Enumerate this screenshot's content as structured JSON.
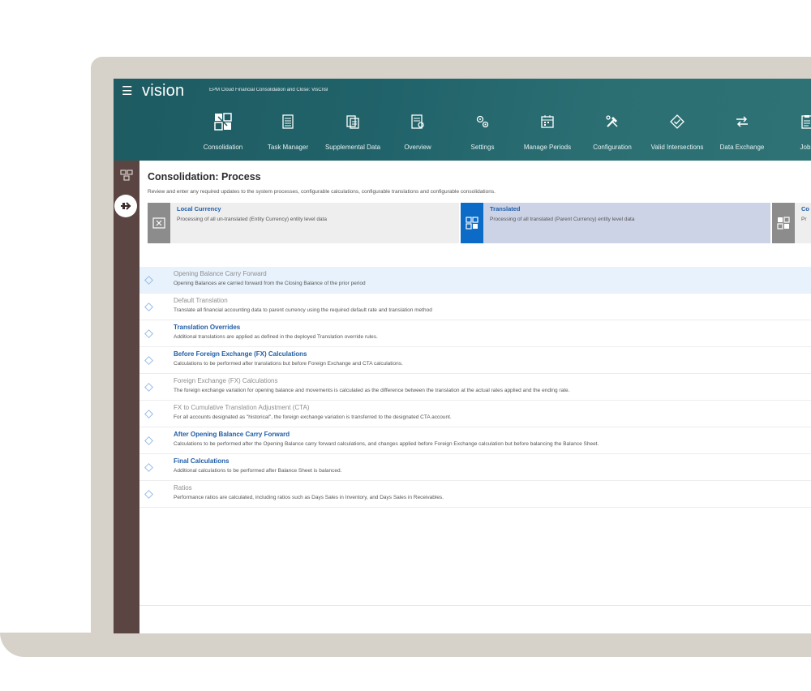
{
  "app": {
    "brand": "vision",
    "title": "EPM Cloud Financial Consolidation and Close: VisCnsl"
  },
  "nav": [
    {
      "label": "Consolidation",
      "icon": "consolidation-icon"
    },
    {
      "label": "Task Manager",
      "icon": "task-manager-icon"
    },
    {
      "label": "Supplemental Data",
      "icon": "supplemental-data-icon"
    },
    {
      "label": "Overview",
      "icon": "overview-icon"
    },
    {
      "label": "Settings",
      "icon": "settings-icon"
    },
    {
      "label": "Manage Periods",
      "icon": "manage-periods-icon"
    },
    {
      "label": "Configuration",
      "icon": "configuration-icon"
    },
    {
      "label": "Valid Intersections",
      "icon": "valid-intersections-icon"
    },
    {
      "label": "Data Exchange",
      "icon": "data-exchange-icon"
    },
    {
      "label": "Jobs",
      "icon": "jobs-icon"
    }
  ],
  "page": {
    "title": "Consolidation: Process",
    "description": "Review and enter any required updates to the system processes, configurable calculations, configurable translations and configurable consolidations."
  },
  "cards": [
    {
      "title": "Local Currency",
      "description": "Processing of all un-translated (Entity Currency) entity level data",
      "selected": false
    },
    {
      "title": "Translated",
      "description": "Processing of all translated (Parent Currency) entity level data",
      "selected": true
    },
    {
      "title": "Co",
      "description": "Pr",
      "selected": false
    }
  ],
  "rows": [
    {
      "title": "Opening Balance Carry Forward",
      "description": "Opening Balances are carried forward from the Closing Balance of the prior period",
      "enabled": false,
      "highlighted": true
    },
    {
      "title": "Default Translation",
      "description": "Translate all financial accounting data to parent currency using the required default rate and translation method",
      "enabled": false,
      "highlighted": false
    },
    {
      "title": "Translation Overrides",
      "description": "Additional translations are applied as defined in the deployed Translation override rules.",
      "enabled": true,
      "highlighted": false
    },
    {
      "title": "Before Foreign Exchange (FX) Calculations",
      "description": "Calculations to be performed after translations but before Foreign Exchange and CTA calculations.",
      "enabled": true,
      "highlighted": false
    },
    {
      "title": "Foreign Exchange (FX) Calculations",
      "description": "The foreign exchange variation for opening balance and movements is calculated as the difference between the translation at the actual rates applied and the ending rate.",
      "enabled": false,
      "highlighted": false
    },
    {
      "title": "FX to Cumulative Translation Adjustment (CTA)",
      "description": "For all accounts designated as \"historical\", the foreign exchange variation is transferred to the designated CTA account.",
      "enabled": false,
      "highlighted": false
    },
    {
      "title": "After Opening Balance Carry Forward",
      "description": "Calculations to be performed after the Opening Balance carry forward calculations, and changes applied before Foreign Exchange calculation but before balancing the Balance Sheet.",
      "enabled": true,
      "highlighted": false
    },
    {
      "title": "Final Calculations",
      "description": "Additional calculations to be performed after Balance Sheet is balanced.",
      "enabled": true,
      "highlighted": false
    },
    {
      "title": "Ratios",
      "description": "Performance ratios are calculated, including ratios such as Days Sales in Inventory, and Days Sales in Receivables.",
      "enabled": false,
      "highlighted": false
    }
  ]
}
